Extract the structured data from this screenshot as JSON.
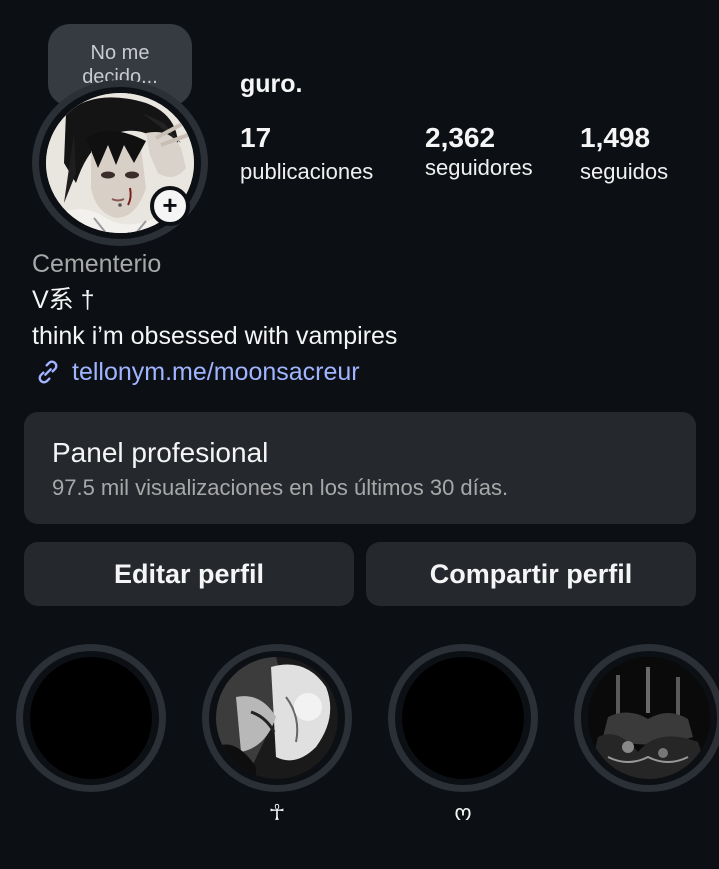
{
  "profile": {
    "note": "No me decido...",
    "username": "guro.",
    "avatar_icon": "avatar-photo",
    "add_story_icon": "plus-icon"
  },
  "stats": {
    "posts": {
      "value": "17",
      "label": "publicaciones"
    },
    "followers": {
      "value": "2,362",
      "label": "seguidores"
    },
    "following": {
      "value": "1,498",
      "label": "seguidos"
    }
  },
  "bio": {
    "category": "Cementerio",
    "line1": "V系 †",
    "line2": "think i’m obsessed with vampires",
    "link": "tellonym.me/moonsacreur",
    "link_icon": "link-icon",
    "link_color": "#a0b4ff"
  },
  "panel": {
    "title": "Panel profesional",
    "subtitle": "97.5 mil visualizaciones en los últimos 30 días."
  },
  "actions": {
    "edit_label": "Editar perfil",
    "share_label": "Compartir perfil"
  },
  "highlights": [
    {
      "label": "",
      "cover": "black"
    },
    {
      "label": "☥",
      "cover": "bw-photo-kiss"
    },
    {
      "label": "ო",
      "cover": "black"
    },
    {
      "label": "",
      "cover": "bw-photo-candles"
    }
  ],
  "colors": {
    "background": "#0c1014",
    "surface": "#25292e",
    "text": "#f5f5f5",
    "muted": "#a8a8a8"
  }
}
